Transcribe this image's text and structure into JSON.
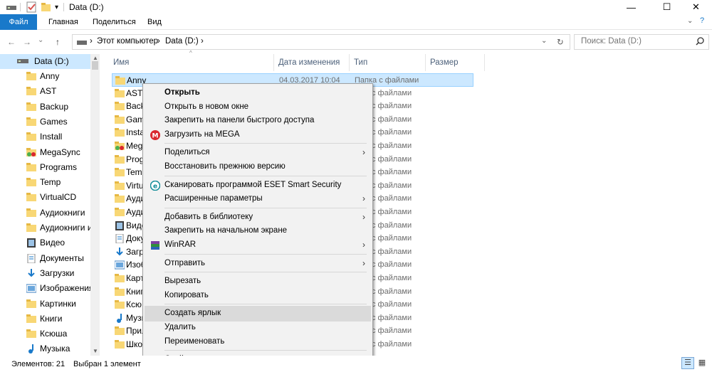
{
  "window": {
    "title": "Data (D:)",
    "min_glyph": "—",
    "max_glyph": "☐",
    "close_glyph": "✕"
  },
  "ribbon": {
    "tabs": [
      "Файл",
      "Главная",
      "Поделиться",
      "Вид"
    ],
    "chevron": "⌄",
    "help": "?"
  },
  "address": {
    "back": "←",
    "forward": "→",
    "recent": "⌄",
    "up": "↑",
    "crumbs": [
      "Этот компьютер",
      "Data (D:)"
    ],
    "sep": "›",
    "dropdown": "⌄",
    "refresh": "↻"
  },
  "search": {
    "placeholder": "Поиск: Data (D:)",
    "icon": "search-icon"
  },
  "nav": {
    "items": [
      {
        "label": "Data (D:)",
        "icon": "drive-icon",
        "selected": true
      },
      {
        "label": "Anny",
        "icon": "folder-icon"
      },
      {
        "label": "AST",
        "icon": "folder-icon"
      },
      {
        "label": "Backup",
        "icon": "folder-icon"
      },
      {
        "label": "Games",
        "icon": "folder-icon"
      },
      {
        "label": "Install",
        "icon": "folder-icon"
      },
      {
        "label": "MegaSync",
        "icon": "mega-folder-icon"
      },
      {
        "label": "Programs",
        "icon": "folder-icon"
      },
      {
        "label": "Temp",
        "icon": "folder-icon"
      },
      {
        "label": "VirtualCD",
        "icon": "folder-icon"
      },
      {
        "label": "Аудиокниги",
        "icon": "folder-icon"
      },
      {
        "label": "Аудиокниги и",
        "icon": "folder-icon"
      },
      {
        "label": "Видео",
        "icon": "video-icon"
      },
      {
        "label": "Документы",
        "icon": "documents-icon"
      },
      {
        "label": "Загрузки",
        "icon": "downloads-icon"
      },
      {
        "label": "Изображения",
        "icon": "pictures-icon"
      },
      {
        "label": "Картинки",
        "icon": "folder-icon"
      },
      {
        "label": "Книги",
        "icon": "folder-icon"
      },
      {
        "label": "Ксюша",
        "icon": "folder-icon"
      },
      {
        "label": "Музыка",
        "icon": "music-icon"
      }
    ]
  },
  "columns": {
    "name": "Имя",
    "date": "Дата изменения",
    "type": "Тип",
    "size": "Размер",
    "sort": "^"
  },
  "files": [
    {
      "name": "Anny",
      "date": "04.03.2017 10:04",
      "type": "Папка с файлами",
      "icon": "folder-icon",
      "selected": true
    },
    {
      "name": "AST",
      "type": "с файлами",
      "icon": "folder-icon"
    },
    {
      "name": "Back",
      "type": "с файлами",
      "icon": "folder-icon"
    },
    {
      "name": "Gam",
      "type": "с файлами",
      "icon": "folder-icon"
    },
    {
      "name": "Insta",
      "type": "с файлами",
      "icon": "folder-icon"
    },
    {
      "name": "Meg",
      "type": "с файлами",
      "icon": "mega-folder-icon"
    },
    {
      "name": "Prog",
      "type": "с файлами",
      "icon": "folder-icon"
    },
    {
      "name": "Temp",
      "type": "с файлами",
      "icon": "folder-icon"
    },
    {
      "name": "Virtu",
      "type": "с файлами",
      "icon": "folder-icon"
    },
    {
      "name": "Ауди",
      "type": "с файлами",
      "icon": "folder-icon"
    },
    {
      "name": "Ауди",
      "type": "с файлами",
      "icon": "folder-icon"
    },
    {
      "name": "Виде",
      "type": "с файлами",
      "icon": "video-icon"
    },
    {
      "name": "Доку",
      "type": "с файлами",
      "icon": "documents-icon"
    },
    {
      "name": "Загр",
      "type": "с файлами",
      "icon": "downloads-icon"
    },
    {
      "name": "Изоб",
      "type": "с файлами",
      "icon": "pictures-icon"
    },
    {
      "name": "Карт",
      "type": "с файлами",
      "icon": "folder-icon"
    },
    {
      "name": "Книг",
      "type": "с файлами",
      "icon": "folder-icon"
    },
    {
      "name": "Ксю",
      "type": "с файлами",
      "icon": "folder-icon"
    },
    {
      "name": "Музы",
      "type": "с файлами",
      "icon": "music-icon"
    },
    {
      "name": "Прил",
      "type": "с файлами",
      "icon": "folder-icon"
    },
    {
      "name": "Школ",
      "type": "с файлами",
      "icon": "folder-icon"
    }
  ],
  "context_menu": {
    "items": [
      {
        "label": "Открыть",
        "bold": true
      },
      {
        "label": "Открыть в новом окне"
      },
      {
        "label": "Закрепить на панели быстрого доступа"
      },
      {
        "label": "Загрузить на MEGA",
        "icon": "mega-icon"
      },
      {
        "sep": true
      },
      {
        "label": "Поделиться",
        "submenu": true
      },
      {
        "label": "Восстановить прежнюю версию"
      },
      {
        "sep": true
      },
      {
        "label": "Сканировать программой ESET Smart Security",
        "icon": "eset-icon"
      },
      {
        "label": "Расширенные параметры",
        "submenu": true
      },
      {
        "sep": true
      },
      {
        "label": "Добавить в библиотеку",
        "submenu": true
      },
      {
        "label": "Закрепить на начальном экране"
      },
      {
        "label": "WinRAR",
        "icon": "winrar-icon",
        "submenu": true
      },
      {
        "sep": true
      },
      {
        "label": "Отправить",
        "submenu": true
      },
      {
        "sep": true
      },
      {
        "label": "Вырезать"
      },
      {
        "label": "Копировать"
      },
      {
        "sep": true
      },
      {
        "label": "Создать ярлык",
        "highlighted": true
      },
      {
        "label": "Удалить"
      },
      {
        "label": "Переименовать"
      },
      {
        "sep": true
      },
      {
        "label": "Свойства"
      }
    ],
    "submenu_glyph": "›"
  },
  "status": {
    "count": "Элементов: 21",
    "selected": "Выбран 1 элемент"
  },
  "colors": {
    "accent": "#1979ca",
    "selection": "#cce8ff",
    "menu_bg": "#f2f2f2",
    "folder": "#f8d775"
  }
}
